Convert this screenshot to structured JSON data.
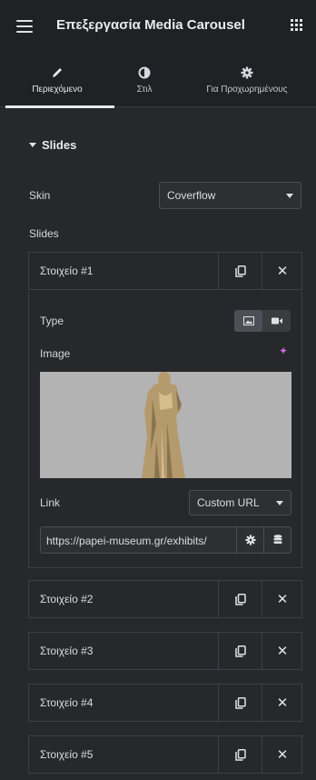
{
  "header": {
    "title": "Επεξεργασία Media Carousel"
  },
  "tabs": [
    {
      "label": "Περιεχόμενο",
      "icon": "pencil-icon",
      "active": true
    },
    {
      "label": "Στιλ",
      "icon": "half-circle-icon",
      "active": false
    },
    {
      "label": "Για Προχωρημένους",
      "icon": "gear-icon",
      "active": false
    }
  ],
  "section": {
    "title": "Slides"
  },
  "skin": {
    "label": "Skin",
    "value": "Coverflow"
  },
  "slides_label": "Slides",
  "items": [
    {
      "title": "Στοιχείο #1",
      "expanded": true
    },
    {
      "title": "Στοιχείο #2"
    },
    {
      "title": "Στοιχείο #3"
    },
    {
      "title": "Στοιχείο #4"
    },
    {
      "title": "Στοιχείο #5"
    }
  ],
  "item_body": {
    "type_label": "Type",
    "type_options": [
      "image-icon",
      "video-camera-icon"
    ],
    "type_selected": "image",
    "image_label": "Image",
    "link_label": "Link",
    "link_value": "Custom URL",
    "url_value": "https://papei-museum.gr/exhibits/"
  },
  "colors": {
    "background": "#27282b",
    "header": "#1f2124",
    "ai_accent": "#c36ad6"
  }
}
